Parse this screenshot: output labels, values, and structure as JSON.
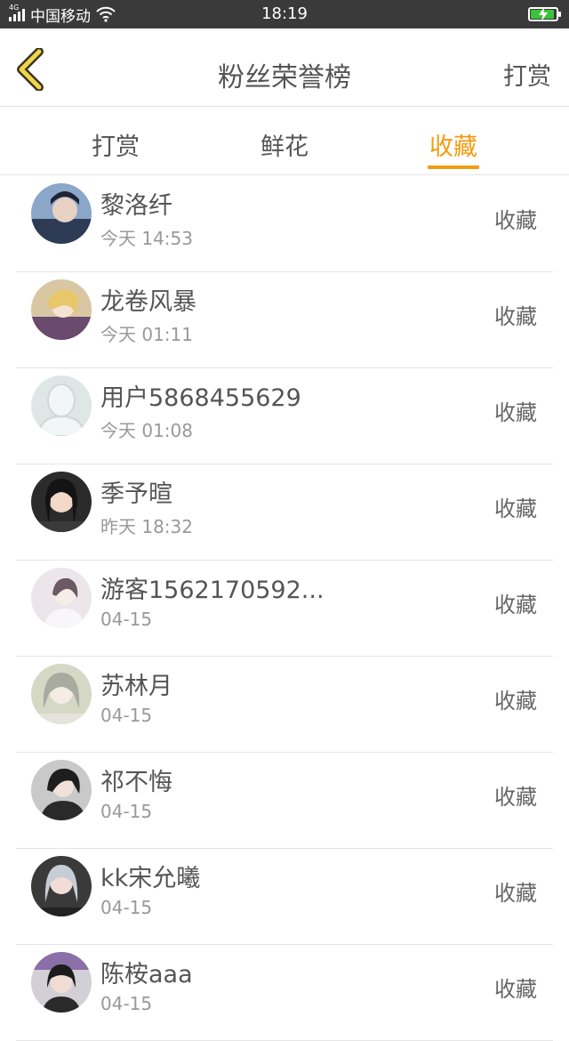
{
  "status_bar": {
    "network": "4G",
    "carrier": "中国移动",
    "time": "18:19"
  },
  "header": {
    "title": "粉丝荣誉榜",
    "right_action": "打赏",
    "back_icon": "chevron-left-icon"
  },
  "tabs": [
    {
      "label": "打赏",
      "active": false
    },
    {
      "label": "鲜花",
      "active": false
    },
    {
      "label": "收藏",
      "active": true
    }
  ],
  "colors": {
    "accent": "#f39c12",
    "statusbar": "#3a3a3a",
    "back_icon": "#f0d44a",
    "battery": "#39c43a"
  },
  "list": [
    {
      "name": "黎洛纤",
      "time": "今天 14:53",
      "action": "收藏"
    },
    {
      "name": "龙卷风暴",
      "time": "今天 01:11",
      "action": "收藏"
    },
    {
      "name": "用户5868455629",
      "time": "今天 01:08",
      "action": "收藏"
    },
    {
      "name": "季予暄",
      "time": "昨天 18:32",
      "action": "收藏"
    },
    {
      "name": "游客1562170592...",
      "time": "04-15",
      "action": "收藏"
    },
    {
      "name": "苏林月",
      "time": "04-15",
      "action": "收藏"
    },
    {
      "name": "祁不悔",
      "time": "04-15",
      "action": "收藏"
    },
    {
      "name": "kk宋允曦",
      "time": "04-15",
      "action": "收藏"
    },
    {
      "name": "陈桉aaa",
      "time": "04-15",
      "action": "收藏"
    }
  ]
}
